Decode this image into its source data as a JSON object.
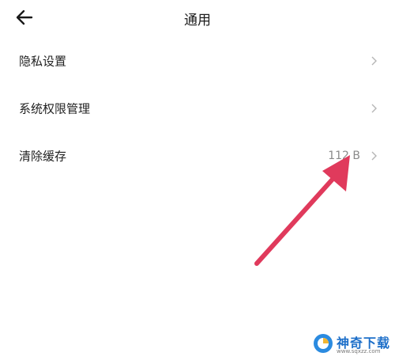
{
  "header": {
    "title": "通用",
    "back_icon": "arrow-left-icon"
  },
  "rows": [
    {
      "label": "隐私设置",
      "value": ""
    },
    {
      "label": "系统权限管理",
      "value": ""
    },
    {
      "label": "清除缓存",
      "value": "112 B"
    }
  ],
  "annotation": {
    "color": "#e03a5c"
  },
  "watermark": {
    "name": "神奇下载",
    "url": "www.sqxzz.com"
  }
}
